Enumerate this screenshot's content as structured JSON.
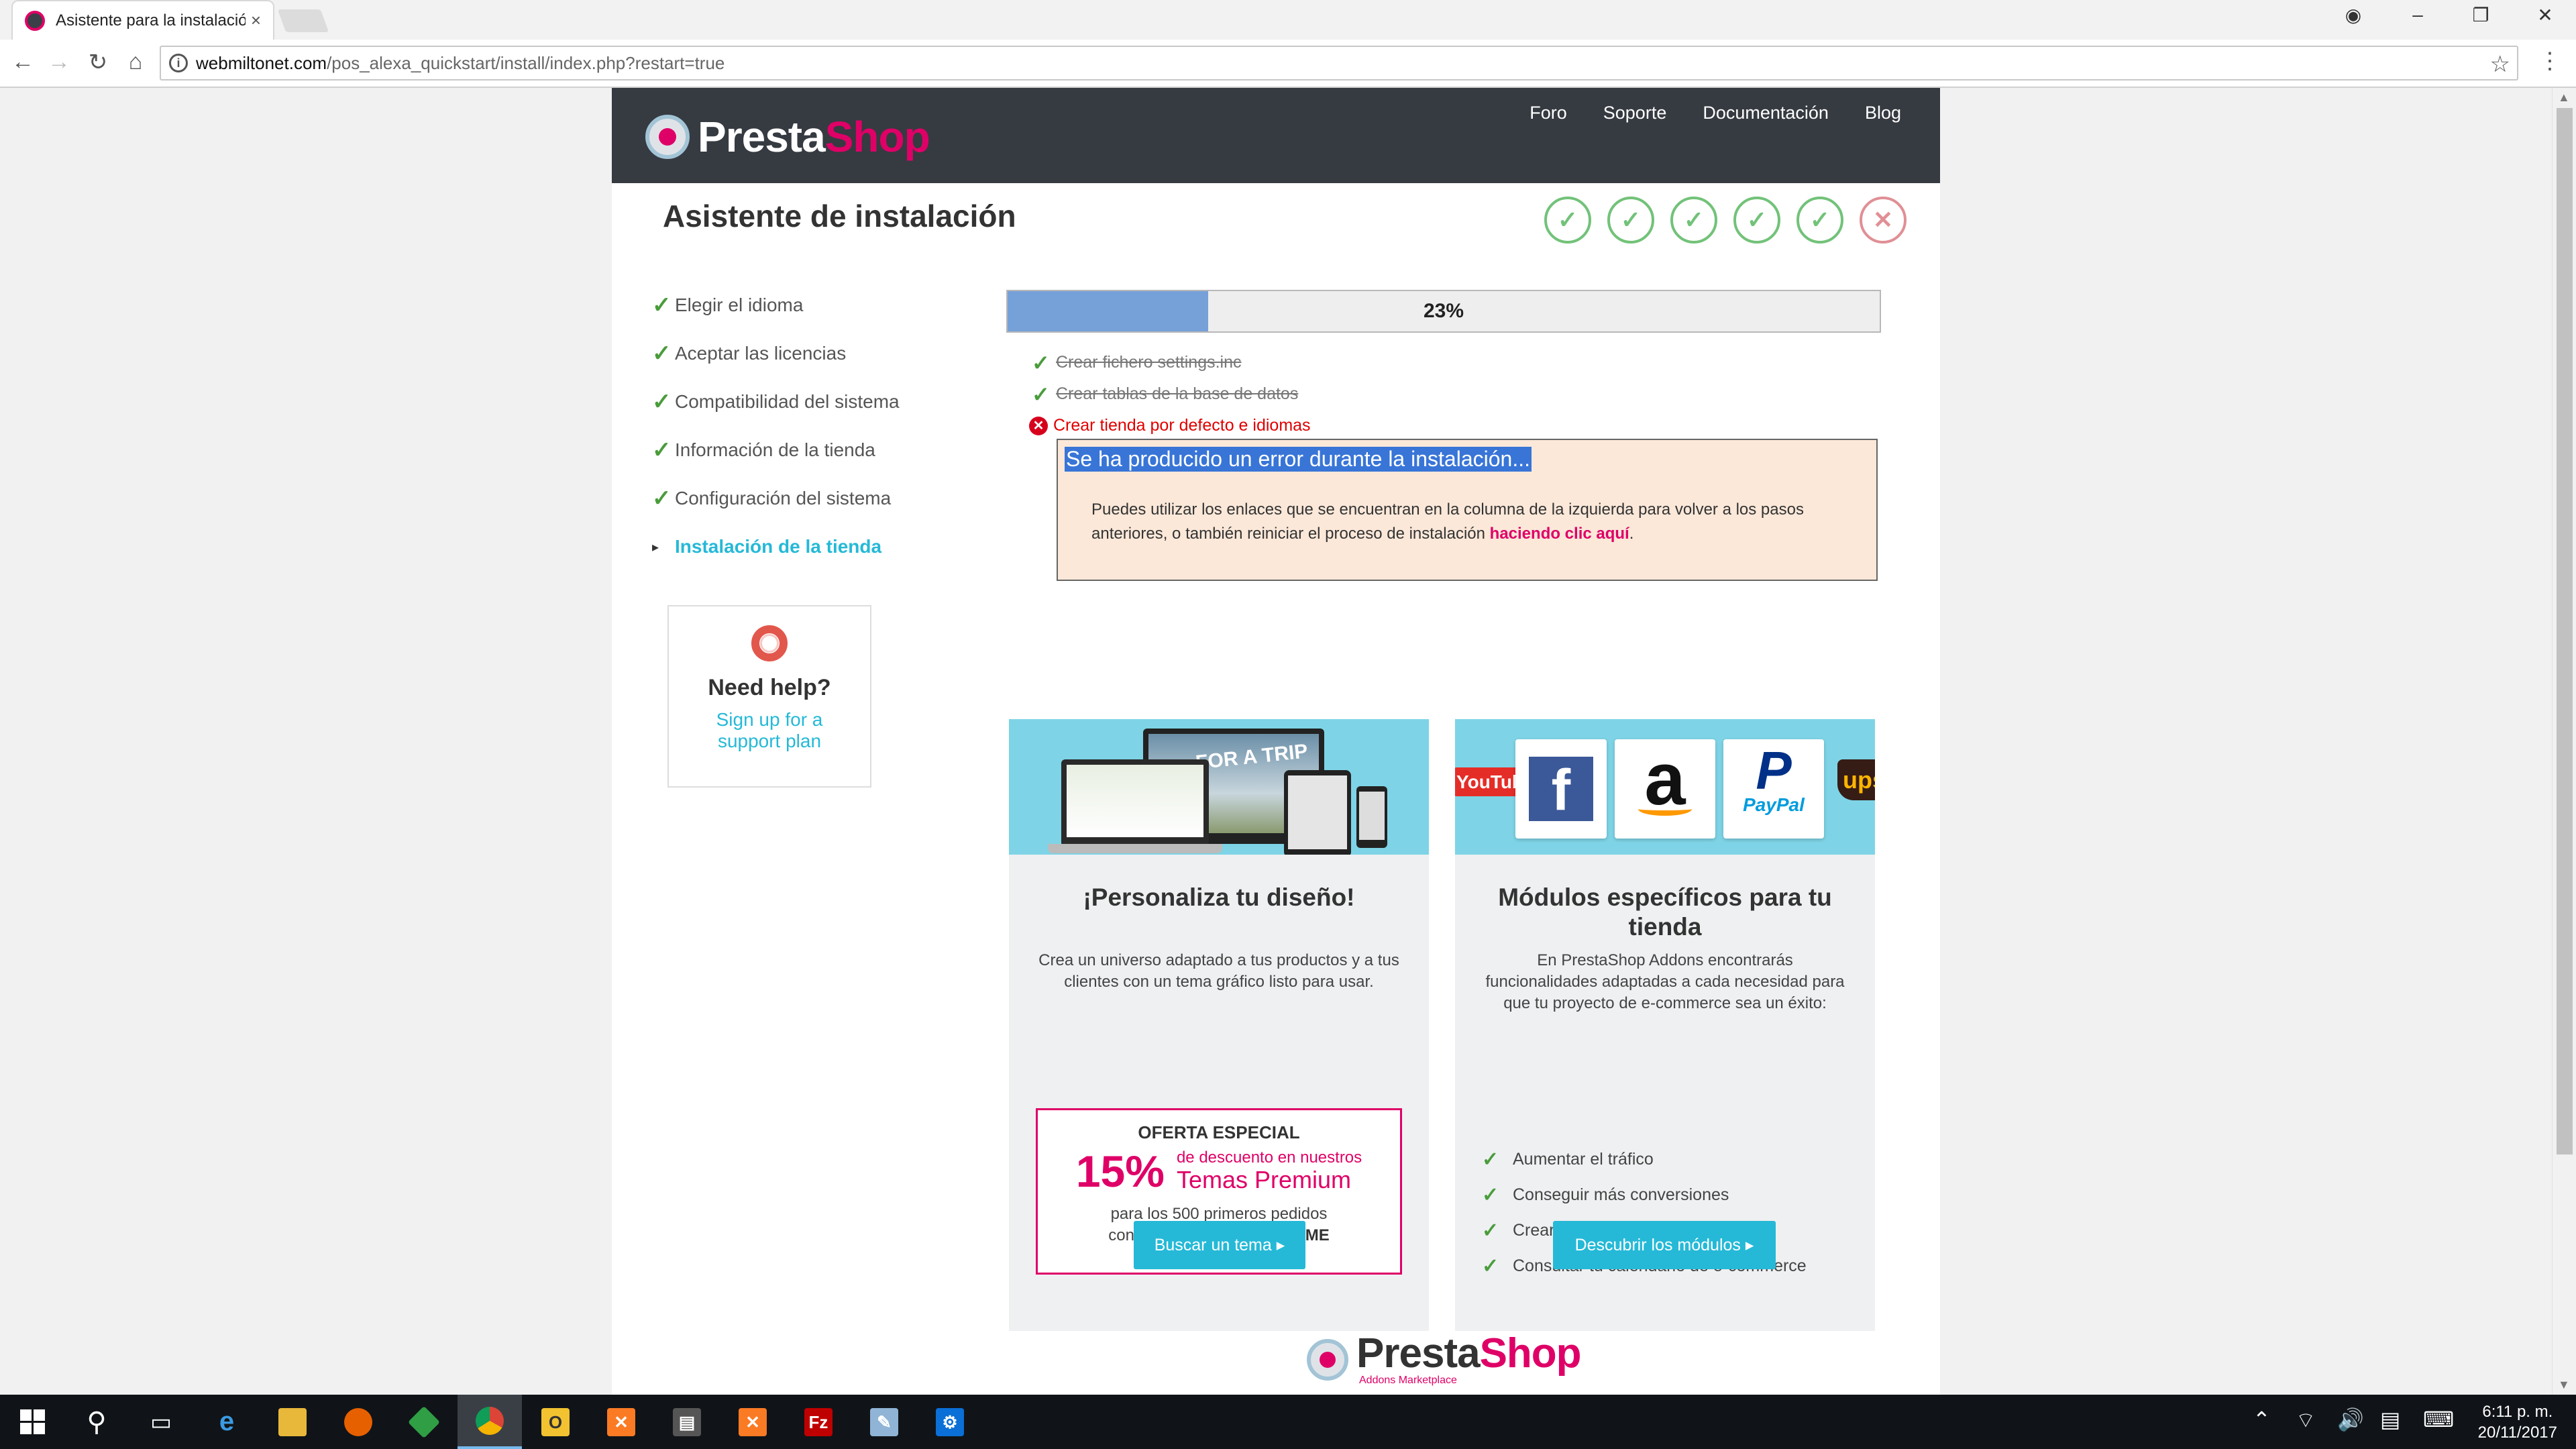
{
  "browser": {
    "tab_title": "Asistente para la instalación",
    "tab_close": "×",
    "url_host": "webmiltonet.com",
    "url_path": "/pos_alexa_quickstart/install/index.php?restart=true"
  },
  "header": {
    "logo_part1": "Presta",
    "logo_part2": "Shop",
    "nav": [
      "Foro",
      "Soporte",
      "Documentación",
      "Blog"
    ]
  },
  "wizard": {
    "title": "Asistente de instalación",
    "step_status": [
      "done",
      "done",
      "done",
      "done",
      "done",
      "error"
    ],
    "steps": [
      {
        "label": "Elegir el idioma",
        "state": "done"
      },
      {
        "label": "Aceptar las licencias",
        "state": "done"
      },
      {
        "label": "Compatibilidad del sistema",
        "state": "done"
      },
      {
        "label": "Información de la tienda",
        "state": "done"
      },
      {
        "label": "Configuración del sistema",
        "state": "done"
      },
      {
        "label": "Instalación de la tienda",
        "state": "current"
      }
    ]
  },
  "help": {
    "title": "Need help?",
    "link_line1": "Sign up for a",
    "link_line2": "support plan"
  },
  "progress": {
    "value": 0.23,
    "label": "23%"
  },
  "tasks": [
    {
      "label": "Crear fichero settings.inc",
      "state": "done"
    },
    {
      "label": "Crear tablas de la base de datos",
      "state": "done"
    },
    {
      "label": "Crear tienda por defecto e idiomas",
      "state": "failed"
    }
  ],
  "error": {
    "title": "Se ha producido un error durante la instalación...",
    "body": "Puedes utilizar los enlaces que se encuentran en la columna de la izquierda para volver a los pasos anteriores, o también reiniciar el proceso de instalación ",
    "link": "haciendo clic aquí",
    "body_end": "."
  },
  "promo_theme": {
    "title": "¡Personaliza tu diseño!",
    "desc": "Crea un universo adaptado a tus productos y a tus clientes con un tema gráfico listo para usar.",
    "offer_title": "OFERTA ESPECIAL",
    "offer_pct": "15%",
    "offer_line_a": "de descuento en nuestros",
    "offer_line_b": "Temas Premium",
    "offer_foot1": "para los 500 primeros pedidos",
    "offer_foot2": "con el código: ",
    "offer_code": "PROMOTHEME",
    "button": "Buscar un tema ▸",
    "banner_caption": "FOR A TRIP"
  },
  "promo_modules": {
    "title": "Módulos específicos para tu tienda",
    "desc": "En PrestaShop Addons encontrarás funcionalidades adaptadas a cada necesidad para que tu proyecto de e-commerce sea un éxito:",
    "benefits": [
      "Aumentar el tráfico",
      "Conseguir más conversiones",
      "Crear promociones cómodamente",
      "Consultar tu calendario de e-commerce"
    ],
    "button": "Descubrir los módulos ▸",
    "logos": {
      "youtube": "YouTube",
      "facebook": "f",
      "amazon": "a",
      "paypal_mark": "P",
      "paypal": "PayPal",
      "ups": "ups"
    }
  },
  "addons_logo": {
    "part1": "Presta",
    "part2": "Shop",
    "sub": "Addons Marketplace"
  },
  "taskbar": {
    "time": "6:11 p. m.",
    "date": "20/11/2017",
    "apps": [
      "start",
      "search",
      "task-view",
      "edge",
      "file-explorer",
      "firefox",
      "app-green",
      "chrome",
      "outlook",
      "xampp",
      "app-dark",
      "xampp-2",
      "filezilla",
      "notepad",
      "settings"
    ],
    "active_app": "chrome"
  }
}
